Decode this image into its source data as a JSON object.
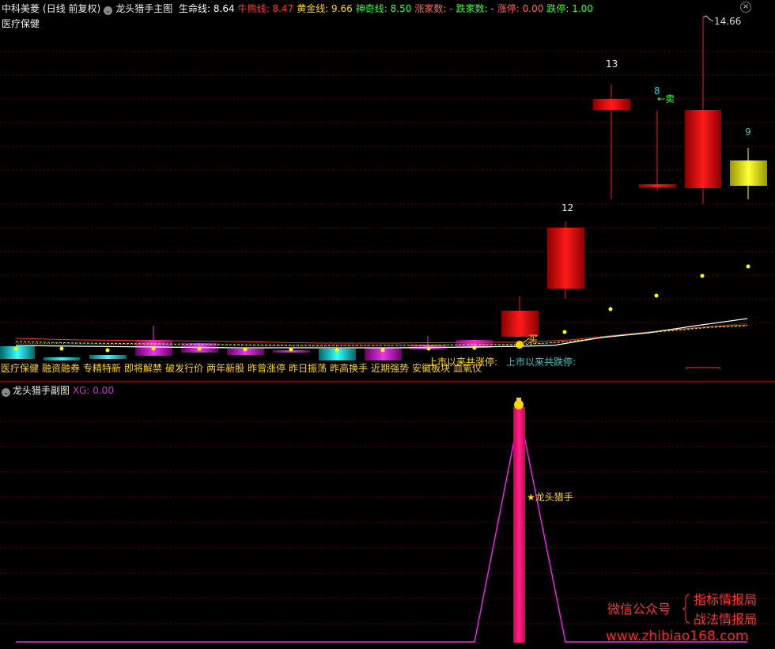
{
  "header": {
    "stock_name": "中科美菱",
    "period": "(日线 前复权)",
    "indicator_name": "龙头猎手主图",
    "lines": [
      {
        "label": "生命线:",
        "value": "8.64",
        "color": "#ffffff"
      },
      {
        "label": "牛熊线:",
        "value": "8.47",
        "color": "#ff3333"
      },
      {
        "label": "黄金线:",
        "value": "9.66",
        "color": "#ffd700"
      },
      {
        "label": "神奇线:",
        "value": "8.50",
        "color": "#33ff33"
      },
      {
        "label": "涨家数:",
        "value": "-",
        "color": "#ff6666"
      },
      {
        "label": "跌家数:",
        "value": "-",
        "color": "#33ff33"
      },
      {
        "label": "涨停:",
        "value": "0.00",
        "color": "#ff6666"
      },
      {
        "label": "跌停:",
        "value": "1.00",
        "color": "#33ff33"
      }
    ]
  },
  "sector_label": "医疗保健",
  "tags": [
    "医疗保健",
    "融资融券",
    "专精特新",
    "即将解禁",
    "破发行价",
    "两年新股",
    "昨曾涨停",
    "昨日振荡",
    "昨高换手",
    "近期强势",
    "安徽板块",
    "血氧仪"
  ],
  "listing_stats": {
    "up_label": "上市以来共涨停:",
    "down_label": "上市以来共跌停:"
  },
  "signals": {
    "buy": "买",
    "sell": "卖"
  },
  "price_high": "14.66",
  "candle_labels": [
    "12",
    "13",
    "8",
    "9"
  ],
  "sub_chart": {
    "title": "龙头猎手副图",
    "xg_label": "XG:",
    "xg_value": "0.00",
    "signal_text": "★龙头猎手"
  },
  "watermark": {
    "wechat": "微信公众号",
    "brand1": "指标情报局",
    "brand2": "战法情报局",
    "url": "www.zhibiao168.com"
  },
  "colors": {
    "up": "#ff0000",
    "down": "#00cccc",
    "magenta": "#cc22cc",
    "yellow": "#ffd700",
    "grid": "#6b0000"
  }
}
